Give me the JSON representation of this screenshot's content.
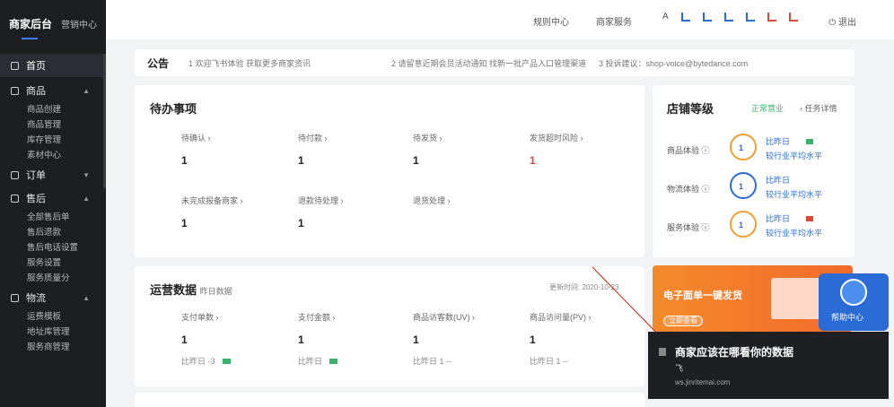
{
  "sidebar": {
    "brand_title": "商家后台",
    "brand_sub": "营销中心",
    "home": "首页",
    "groups": [
      {
        "label": "商品",
        "items": [
          "商品创建",
          "商品管理",
          "库存管理",
          "素材中心"
        ]
      },
      {
        "label": "订单",
        "items": []
      },
      {
        "label": "售后",
        "items": [
          "全部售后单",
          "售后退款",
          "售后电话设置",
          "服务设置",
          "服务质量分"
        ]
      },
      {
        "label": "物流",
        "items": [
          "运费模板",
          "地址库管理",
          "服务商管理"
        ]
      }
    ]
  },
  "topbar": {
    "links": [
      "规则中心",
      "商家服务"
    ],
    "account_prefix": "A",
    "logout": "退出"
  },
  "notice": {
    "title": "公告",
    "items": [
      "1 欢迎飞书体验 获取更多商家资讯",
      "2 请留意近期会员活动通知 找新一批产品入口管理渠道",
      "3 投诉建议：shop-voice@bytedance.com"
    ]
  },
  "todo": {
    "title": "待办事项",
    "items": [
      {
        "label": "待确认 ›",
        "value": "1"
      },
      {
        "label": "待付款 ›",
        "value": "1"
      },
      {
        "label": "待发货 ›",
        "value": "1"
      },
      {
        "label": "发货超时风险 ›",
        "value": "1"
      },
      {
        "label": "未完成报备商家 ›",
        "value": "1"
      },
      {
        "label": "退款待处理 ›",
        "value": "1"
      },
      {
        "label": "退货处理 ›",
        "value": ""
      }
    ]
  },
  "shop": {
    "title": "店铺等级",
    "status": "正常营业",
    "link": "› 任务详情",
    "metrics": [
      {
        "label": "商品体验 ⓘ",
        "value": "1",
        "line1": "比昨日",
        "line2": "较行业平均水平"
      },
      {
        "label": "物流体验 ⓘ",
        "value": "1",
        "line1": "比昨日",
        "line2": "较行业平均水平"
      },
      {
        "label": "服务体验 ⓘ",
        "value": "1",
        "line1": "比昨日",
        "line2": "较行业平均水平"
      }
    ]
  },
  "ops": {
    "title": "运营数据",
    "subtitle": "昨日数据",
    "updated": "更新时间: 2020-10-23",
    "items": [
      {
        "label": "支付单数 ›",
        "value": "1",
        "compare": "比昨日 -3"
      },
      {
        "label": "支付金额 ›",
        "value": "1",
        "compare": "比昨日"
      },
      {
        "label": "商品访客数(UV) ›",
        "value": "1",
        "compare": "比昨日 1 --"
      },
      {
        "label": "商品访问量(PV) ›",
        "value": "1",
        "compare": "比昨日 1 --"
      }
    ]
  },
  "banner": {
    "title": "电子面单一键发货",
    "button": "立即查看"
  },
  "help": {
    "label": "帮助中心"
  },
  "toast": {
    "title": "商家应该在哪看你的数据",
    "sub": "飞",
    "url": "ws.jinritemai.com"
  },
  "colors": {
    "sidebar_bg": "#1c1e22",
    "accent": "#2a6bd6",
    "banner": "#f48a2c",
    "toast_bg": "#1e1f22"
  }
}
